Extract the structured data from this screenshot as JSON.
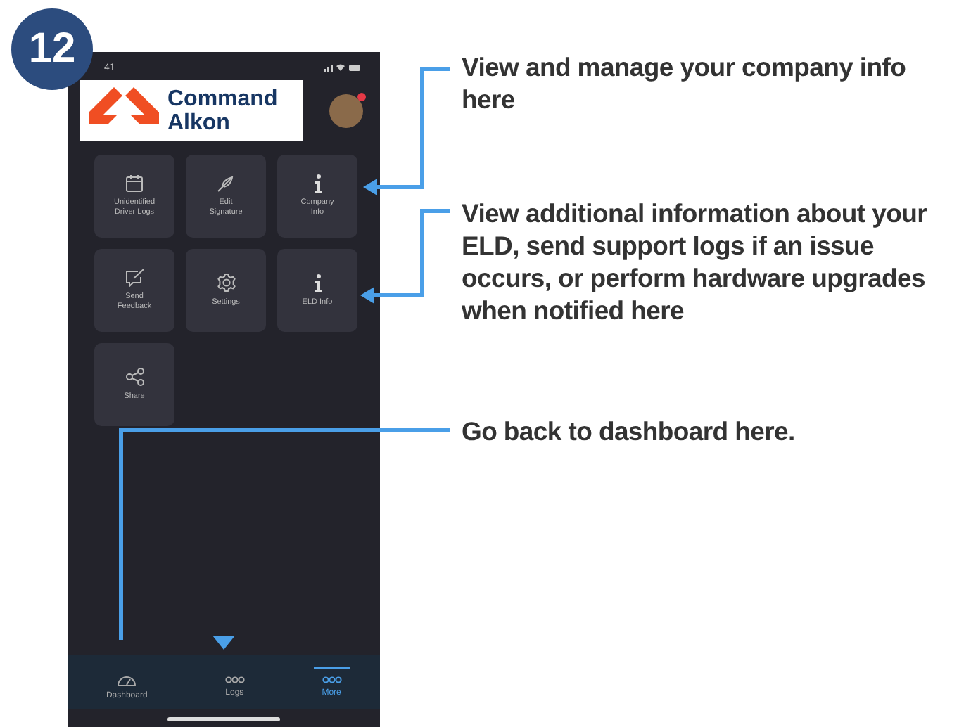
{
  "step_badge": "12",
  "phone": {
    "status_time": "41",
    "logo": {
      "line_1": "Command",
      "line_2": "Alkon"
    },
    "tiles": [
      {
        "label": "Unidentified Driver Logs",
        "kind": "calendar"
      },
      {
        "label": "Edit Signature",
        "kind": "signature"
      },
      {
        "label": "Company Info",
        "kind": "info"
      },
      {
        "label": "Send Feedback",
        "kind": "feedback"
      },
      {
        "label": "Settings",
        "kind": "settings"
      },
      {
        "label": "ELD Info",
        "kind": "info"
      },
      {
        "label": "Share",
        "kind": "share"
      }
    ],
    "tab_bar": [
      {
        "label": "Dashboard",
        "kind": "gauge",
        "selected": false
      },
      {
        "label": "Logs",
        "kind": "dots",
        "selected": false
      },
      {
        "label": "More",
        "kind": "dots",
        "selected": true
      }
    ]
  },
  "notes": [
    {
      "text": "View and manage your company info here"
    },
    {
      "text": "View additional information about your ELD, send support logs if an issue occurs, or perform hardware upgrades when notified here"
    },
    {
      "text": "Go back to dashboard here."
    }
  ]
}
